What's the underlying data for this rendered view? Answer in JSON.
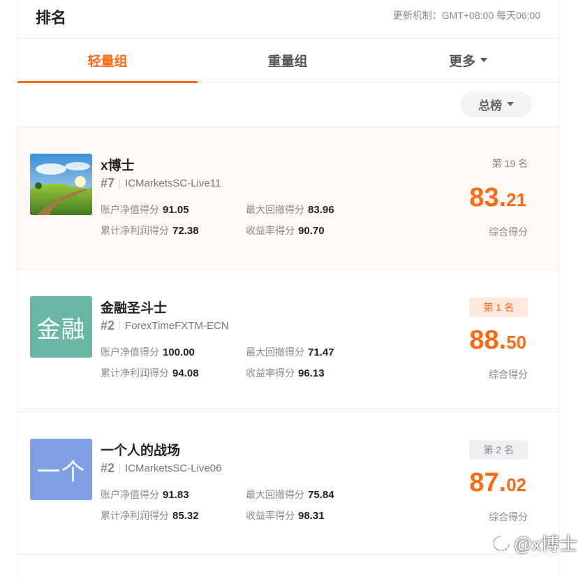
{
  "header": {
    "title": "排名",
    "update_info": "更新机制：GMT+08:00 每天06:00"
  },
  "tabs": [
    {
      "label": "轻量组",
      "active": true
    },
    {
      "label": "重量组",
      "active": false
    },
    {
      "label": "更多",
      "active": false
    }
  ],
  "filter": {
    "label": "总榜"
  },
  "cards": [
    {
      "name": "x博士",
      "rank_hash": "#7",
      "server": "ICMarketsSC-Live11",
      "avatar_text": "",
      "avatar_color": "#5a9b3a",
      "metrics": [
        {
          "label": "账户净值得分",
          "value": "91.05"
        },
        {
          "label": "最大回撤得分",
          "value": "83.96"
        },
        {
          "label": "累计净利润得分",
          "value": "72.38"
        },
        {
          "label": "收益率得分",
          "value": "90.70"
        }
      ],
      "position": "第 19 名",
      "score_int": "83.",
      "score_dec": "21",
      "score_label": "综合得分"
    },
    {
      "name": "金融圣斗士",
      "rank_hash": "#2",
      "server": "ForexTimeFXTM-ECN",
      "avatar_text": "金融",
      "avatar_color": "#69b8a5",
      "metrics": [
        {
          "label": "账户净值得分",
          "value": "100.00"
        },
        {
          "label": "最大回撤得分",
          "value": "71.47"
        },
        {
          "label": "累计净利润得分",
          "value": "94.08"
        },
        {
          "label": "收益率得分",
          "value": "96.13"
        }
      ],
      "position": "第 1 名",
      "score_int": "88.",
      "score_dec": "50",
      "score_label": "综合得分"
    },
    {
      "name": "一个人的战场",
      "rank_hash": "#2",
      "server": "ICMarketsSC-Live06",
      "avatar_text": "一个",
      "avatar_color": "#7f9fe6",
      "metrics": [
        {
          "label": "账户净值得分",
          "value": "91.83"
        },
        {
          "label": "最大回撤得分",
          "value": "75.84"
        },
        {
          "label": "累计净利润得分",
          "value": "85.32"
        },
        {
          "label": "收益率得分",
          "value": "98.31"
        }
      ],
      "position": "第 2 名",
      "score_int": "87.",
      "score_dec": "02",
      "score_label": "综合得分"
    }
  ],
  "colors": {
    "accent": "#ff6a13"
  },
  "watermark": {
    "text": "@x博士"
  }
}
